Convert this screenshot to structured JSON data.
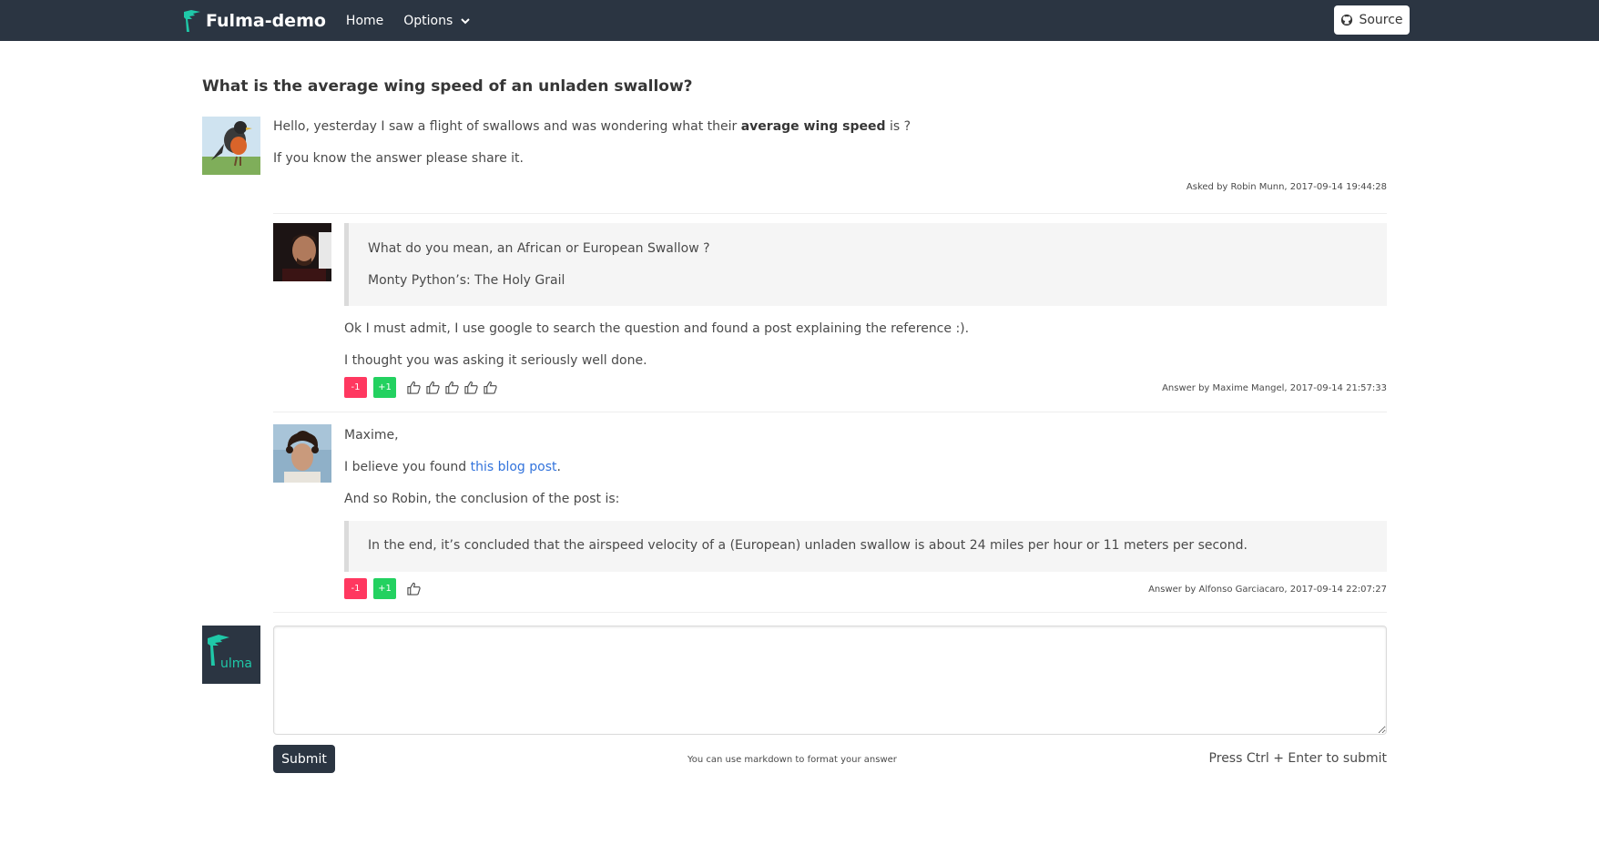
{
  "navbar": {
    "brand": "Fulma-demo",
    "home": "Home",
    "options": "Options",
    "source": "Source"
  },
  "question": {
    "title": "What is the average wing speed of an unladen swallow?",
    "line1_prefix": "Hello, yesterday I saw a flight of swallows and was wondering what their ",
    "line1_bold": "average wing speed",
    "line1_suffix": " is ?",
    "line2": "If you know the answer please share it.",
    "meta": "Asked by Robin Munn, 2017-09-14 19:44:28"
  },
  "answers": [
    {
      "quote_line1": "What do you mean, an African or European Swallow ?",
      "quote_line2": "Monty Python’s: The Holy Grail",
      "line1": "Ok I must admit, I use google to search the question and found a post explaining the reference :).",
      "line2": "I thought you was asking it seriously well done.",
      "minus": "-1",
      "plus": "+1",
      "meta": "Answer by Maxime Mangel, 2017-09-14 21:57:33"
    },
    {
      "line1": "Maxime,",
      "line2_prefix": "I believe you found ",
      "line2_link": "this blog post",
      "line2_suffix": ".",
      "line3": "And so Robin, the conclusion of the post is:",
      "quote": "In the end, it’s concluded that the airspeed velocity of a (European) unladen swallow is about 24 miles per hour or 11 meters per second.",
      "minus": "-1",
      "plus": "+1",
      "meta": "Answer by Alfonso Garciacaro, 2017-09-14 22:07:27"
    }
  ],
  "reply": {
    "avatar_text": "ulma",
    "submit": "Submit",
    "markdown_hint": "You can use markdown to format your answer",
    "shortcut_hint": "Press Ctrl + Enter to submit"
  },
  "colors": {
    "navbar": "#2b3542",
    "accent": "#1fc8a8",
    "danger": "#ff3860",
    "success": "#23d160",
    "link": "#3273dc"
  }
}
